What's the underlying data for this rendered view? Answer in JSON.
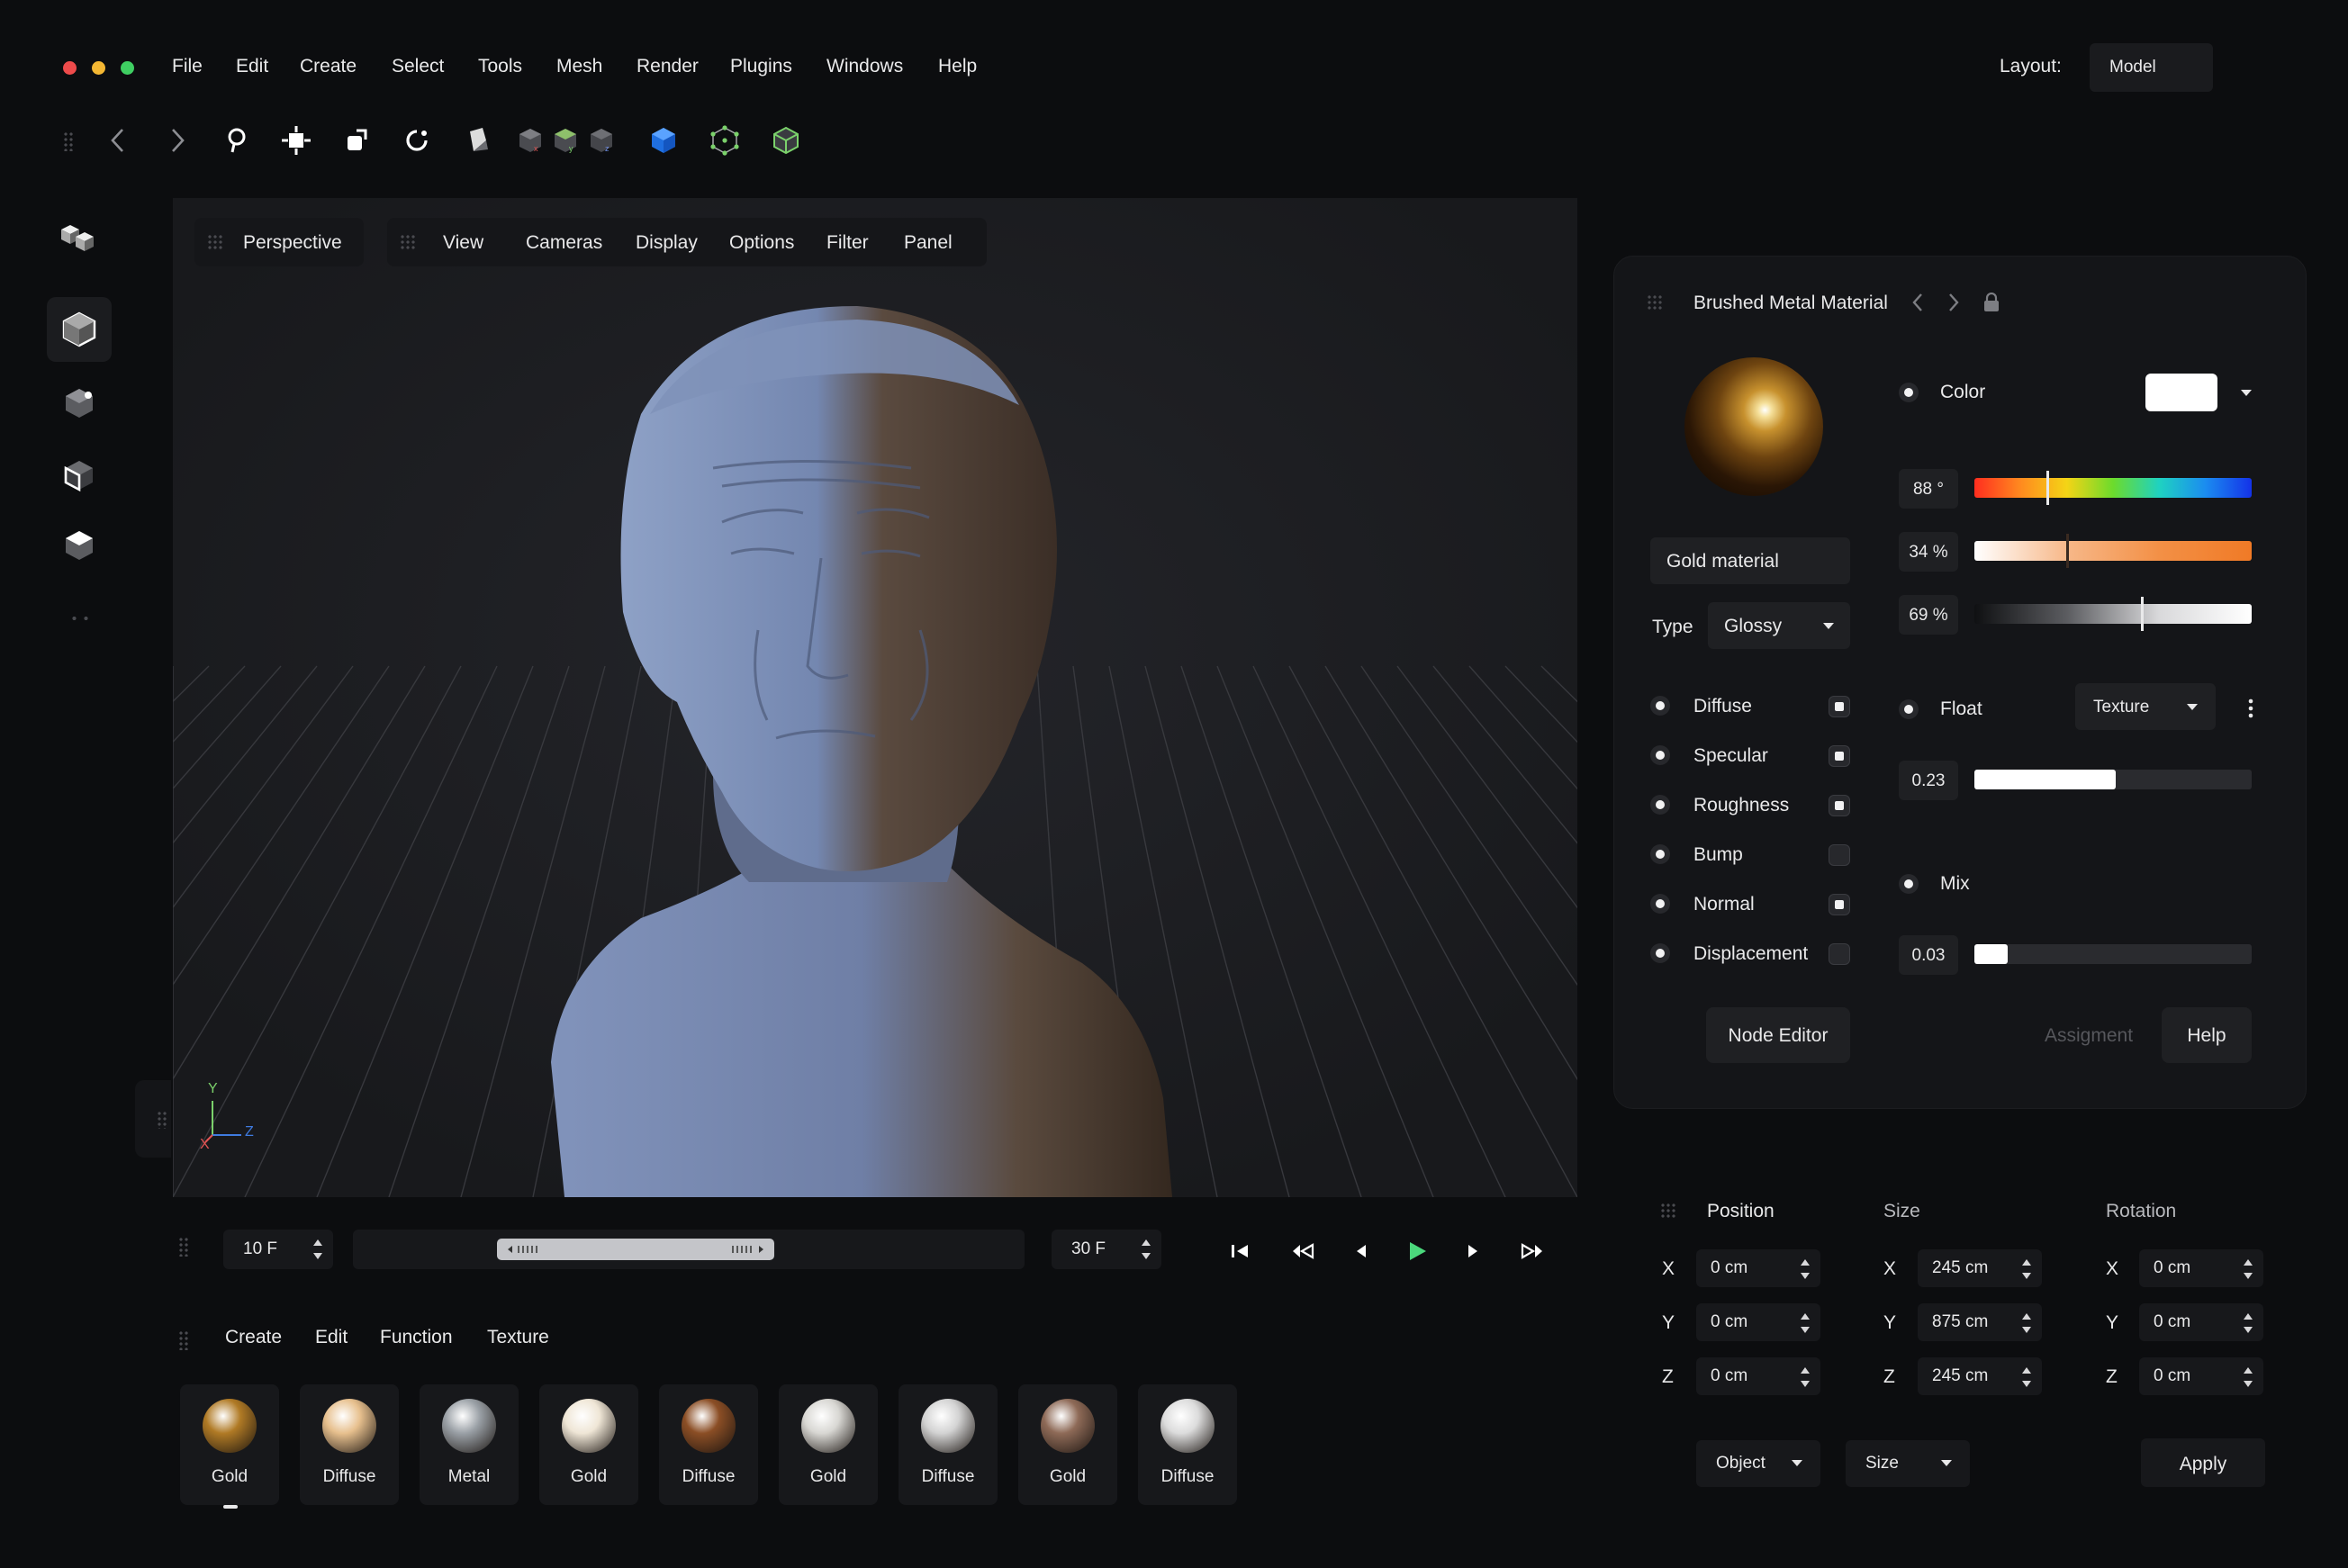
{
  "menu": {
    "items": [
      "File",
      "Edit",
      "Create",
      "Select",
      "Tools",
      "Mesh",
      "Render",
      "Plugins",
      "Windows",
      "Help"
    ],
    "layout_label": "Layout:",
    "layout_value": "Model"
  },
  "toolbar": {
    "icons": [
      "back-icon",
      "forward-icon",
      "lasso-icon",
      "move-icon",
      "scale-icon",
      "rotate-icon",
      "snap-icon",
      "axis-x-cube-icon",
      "axis-y-cube-icon",
      "axis-z-cube-icon",
      "solid-cube-icon",
      "points-cube-icon",
      "edges-cube-icon"
    ]
  },
  "viewport": {
    "camera": "Perspective",
    "menu": [
      "View",
      "Cameras",
      "Display",
      "Options",
      "Filter",
      "Panel"
    ],
    "axis_labels": {
      "x": "X",
      "y": "Y",
      "z": "Z"
    }
  },
  "timeline": {
    "start": "10 F",
    "end": "30 F"
  },
  "materials": {
    "menu": [
      "Create",
      "Edit",
      "Function",
      "Texture"
    ],
    "items": [
      {
        "name": "Gold",
        "color": "#b07a25"
      },
      {
        "name": "Diffuse",
        "color": "#e7c08e"
      },
      {
        "name": "Metal",
        "color": "#9aa0a6"
      },
      {
        "name": "Gold",
        "color": "#efe6d6"
      },
      {
        "name": "Diffuse",
        "color": "#8b4e25"
      },
      {
        "name": "Gold",
        "color": "#d8d7d3"
      },
      {
        "name": "Diffuse",
        "color": "#d3d3d3"
      },
      {
        "name": "Gold",
        "color": "#8e6a57"
      },
      {
        "name": "Diffuse",
        "color": "#dcdcdc"
      }
    ]
  },
  "material_panel": {
    "title": "Brushed Metal Material",
    "name_value": "Gold material",
    "type_label": "Type",
    "type_value": "Glossy",
    "channels": [
      {
        "label": "Diffuse",
        "enabled": true
      },
      {
        "label": "Specular",
        "enabled": true
      },
      {
        "label": "Roughness",
        "enabled": true
      },
      {
        "label": "Bump",
        "enabled": false
      },
      {
        "label": "Normal",
        "enabled": true
      },
      {
        "label": "Displacement",
        "enabled": false
      }
    ],
    "color_label": "Color",
    "color_value": "#ffffff",
    "hue": "88 °",
    "saturation": "34 %",
    "brightness": "69 %",
    "hue_level": 0.26,
    "saturation_level": 0.33,
    "brightness_level": 0.6,
    "float_label": "Float",
    "float_source": "Texture",
    "float_value": "0.23",
    "float_level": 0.51,
    "mix_label": "Mix",
    "mix_value": "0.03",
    "mix_level": 0.12,
    "buttons": {
      "node_editor": "Node Editor",
      "assignment": "Assigment",
      "help": "Help"
    }
  },
  "transform": {
    "headers": [
      "Position",
      "Size",
      "Rotation"
    ],
    "axes": [
      "X",
      "Y",
      "Z"
    ],
    "position": [
      "0 cm",
      "0 cm",
      "0 cm"
    ],
    "size": [
      "245 cm",
      "875 cm",
      "245 cm"
    ],
    "rotation": [
      "0 cm",
      "0 cm",
      "0 cm"
    ],
    "object_label": "Object",
    "size_mode": "Size",
    "apply_label": "Apply"
  }
}
